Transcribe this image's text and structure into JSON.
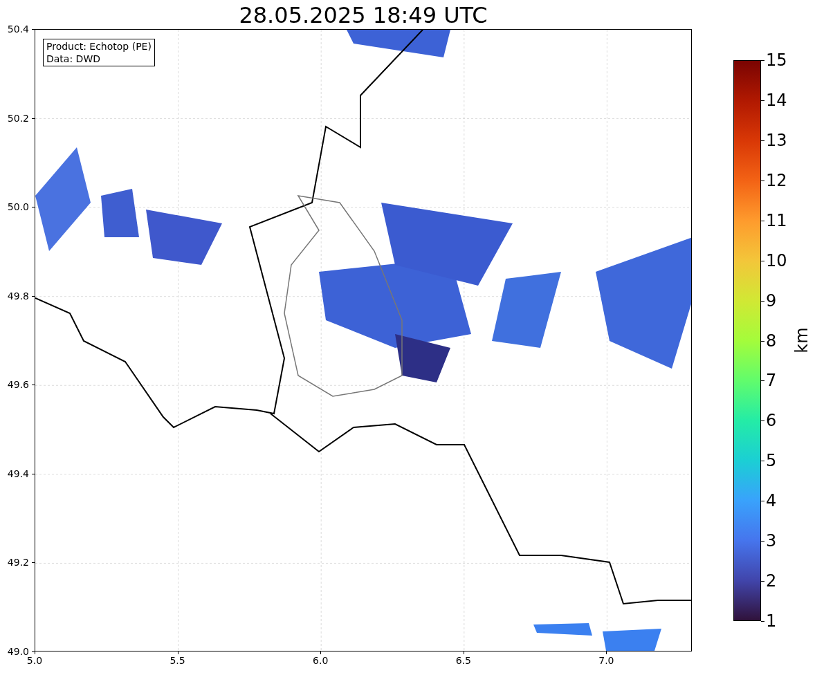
{
  "title": "28.05.2025 18:49 UTC",
  "legend": [
    "Product: Echotop (PE)",
    "Data: DWD"
  ],
  "map": {
    "y_ticks": [
      "50.4",
      "50.2",
      "50.0",
      "49.8",
      "49.6",
      "49.4",
      "49.2",
      "49.0"
    ],
    "x_ticks": [
      "5.0",
      "5.5",
      "6.0",
      "6.5",
      "7.0"
    ]
  },
  "colorbar": {
    "label": "km",
    "ticks": [
      "15",
      "14",
      "13",
      "12",
      "11",
      "10",
      "9",
      "8",
      "7",
      "6",
      "5",
      "4",
      "3",
      "2",
      "1"
    ]
  }
}
